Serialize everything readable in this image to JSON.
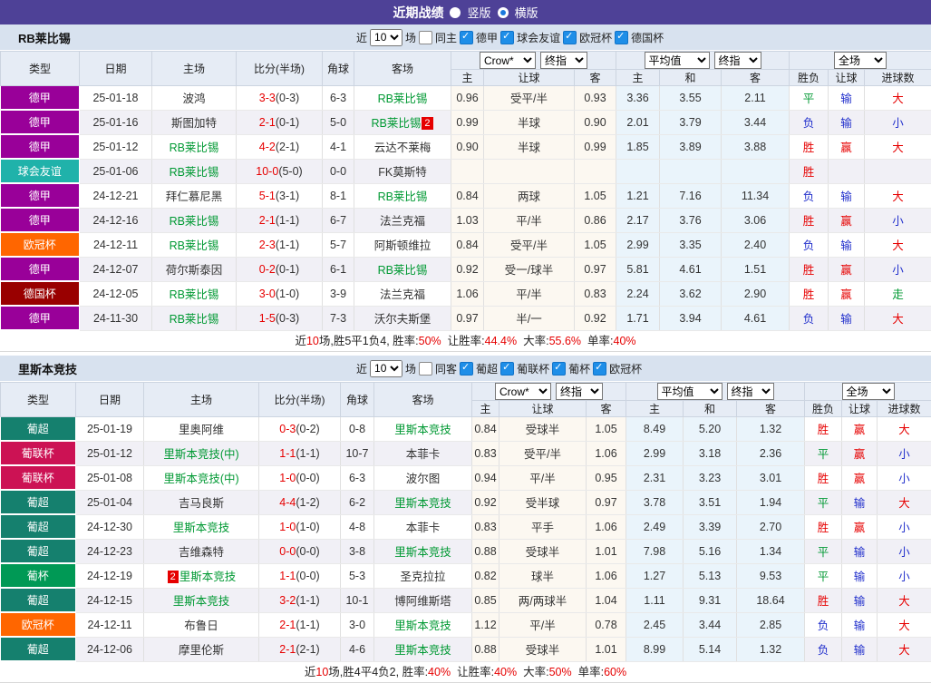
{
  "header": {
    "title": "近期战绩",
    "radio_vertical_label": "竖版",
    "radio_horizontal_label": "横版",
    "selected_layout": "横版"
  },
  "controls": {
    "near_label": "近",
    "near_value": "10",
    "matches_label": "场",
    "bookmaker": "Crow*",
    "final_odds_1": "终指",
    "average": "平均值",
    "final_odds_2": "终指",
    "scope": "全场"
  },
  "columns": {
    "type": "类型",
    "date": "日期",
    "home": "主场",
    "score": "比分(半场)",
    "corner": "角球",
    "away": "客场",
    "h": "主",
    "handicap": "让球",
    "a": "客",
    "avg_h": "主",
    "avg_d": "和",
    "avg_a": "客",
    "wdl": "胜负",
    "let_result": "让球",
    "goals": "进球数"
  },
  "league_colors": {
    "德甲": "#990099",
    "球会友谊": "#20b2aa",
    "欧冠杯": "#ff6600",
    "德国杯": "#990000",
    "葡超": "#15806e",
    "葡联杯": "#cc1254",
    "葡杯": "#009955"
  },
  "result_colors": {
    "胜": "#e60000",
    "平": "#009933",
    "负": "#2230cc",
    "赢": "#e60000",
    "输": "#2230cc",
    "大": "#e60000",
    "小": "#2230cc",
    "走": "#009933"
  },
  "accent_colors": {
    "topbar_purple": "#4e4197",
    "team_green": "#009933",
    "score_red": "#e60000",
    "checkbox_blue": "#1e8ee8"
  },
  "sections": [
    {
      "team": "RB莱比锡",
      "same_label": "同主",
      "same_checked": false,
      "filters": [
        "德甲",
        "球会友谊",
        "欧冠杯",
        "德国杯"
      ],
      "rows": [
        {
          "league": "德甲",
          "date": "25-01-18",
          "home": "波鸿",
          "home_team": false,
          "score": "3-3",
          "half": "(0-3)",
          "corner": "6-3",
          "away": "RB莱比锡",
          "away_team": true,
          "odds": [
            "0.96",
            "受平/半",
            "0.93"
          ],
          "avg": [
            "3.36",
            "3.55",
            "2.11"
          ],
          "res": [
            "平",
            "输",
            "大"
          ]
        },
        {
          "league": "德甲",
          "date": "25-01-16",
          "home": "斯图加特",
          "home_team": false,
          "score": "2-1",
          "half": "(0-1)",
          "corner": "5-0",
          "away": "RB莱比锡",
          "away_team": true,
          "away_badge": "2",
          "away_badge_pos": "after",
          "odds": [
            "0.99",
            "半球",
            "0.90"
          ],
          "avg": [
            "2.01",
            "3.79",
            "3.44"
          ],
          "res": [
            "负",
            "输",
            "小"
          ]
        },
        {
          "league": "德甲",
          "date": "25-01-12",
          "home": "RB莱比锡",
          "home_team": true,
          "score": "4-2",
          "half": "(2-1)",
          "corner": "4-1",
          "away": "云达不莱梅",
          "away_team": false,
          "odds": [
            "0.90",
            "半球",
            "0.99"
          ],
          "avg": [
            "1.85",
            "3.89",
            "3.88"
          ],
          "res": [
            "胜",
            "赢",
            "大"
          ]
        },
        {
          "league": "球会友谊",
          "date": "25-01-06",
          "home": "RB莱比锡",
          "home_team": true,
          "score": "10-0",
          "half": "(5-0)",
          "corner": "0-0",
          "away": "FK莫斯特",
          "away_team": false,
          "odds": [
            "",
            "",
            ""
          ],
          "avg": [
            "",
            "",
            ""
          ],
          "res": [
            "胜",
            "",
            ""
          ]
        },
        {
          "league": "德甲",
          "date": "24-12-21",
          "home": "拜仁慕尼黑",
          "home_team": false,
          "score": "5-1",
          "half": "(3-1)",
          "corner": "8-1",
          "away": "RB莱比锡",
          "away_team": true,
          "odds": [
            "0.84",
            "两球",
            "1.05"
          ],
          "avg": [
            "1.21",
            "7.16",
            "11.34"
          ],
          "res": [
            "负",
            "输",
            "大"
          ]
        },
        {
          "league": "德甲",
          "date": "24-12-16",
          "home": "RB莱比锡",
          "home_team": true,
          "score": "2-1",
          "half": "(1-1)",
          "corner": "6-7",
          "away": "法兰克福",
          "away_team": false,
          "odds": [
            "1.03",
            "平/半",
            "0.86"
          ],
          "avg": [
            "2.17",
            "3.76",
            "3.06"
          ],
          "res": [
            "胜",
            "赢",
            "小"
          ]
        },
        {
          "league": "欧冠杯",
          "date": "24-12-11",
          "home": "RB莱比锡",
          "home_team": true,
          "score": "2-3",
          "half": "(1-1)",
          "corner": "5-7",
          "away": "阿斯顿维拉",
          "away_team": false,
          "odds": [
            "0.84",
            "受平/半",
            "1.05"
          ],
          "avg": [
            "2.99",
            "3.35",
            "2.40"
          ],
          "res": [
            "负",
            "输",
            "大"
          ]
        },
        {
          "league": "德甲",
          "date": "24-12-07",
          "home": "荷尔斯泰因",
          "home_team": false,
          "score": "0-2",
          "half": "(0-1)",
          "corner": "6-1",
          "away": "RB莱比锡",
          "away_team": true,
          "odds": [
            "0.92",
            "受一/球半",
            "0.97"
          ],
          "avg": [
            "5.81",
            "4.61",
            "1.51"
          ],
          "res": [
            "胜",
            "赢",
            "小"
          ]
        },
        {
          "league": "德国杯",
          "date": "24-12-05",
          "home": "RB莱比锡",
          "home_team": true,
          "score": "3-0",
          "half": "(1-0)",
          "corner": "3-9",
          "away": "法兰克福",
          "away_team": false,
          "odds": [
            "1.06",
            "平/半",
            "0.83"
          ],
          "avg": [
            "2.24",
            "3.62",
            "2.90"
          ],
          "res": [
            "胜",
            "赢",
            "走"
          ]
        },
        {
          "league": "德甲",
          "date": "24-11-30",
          "home": "RB莱比锡",
          "home_team": true,
          "score": "1-5",
          "half": "(0-3)",
          "corner": "7-3",
          "away": "沃尔夫斯堡",
          "away_team": false,
          "odds": [
            "0.97",
            "半/一",
            "0.92"
          ],
          "avg": [
            "1.71",
            "3.94",
            "4.61"
          ],
          "res": [
            "负",
            "输",
            "大"
          ]
        }
      ],
      "summary": {
        "parts": [
          {
            "t": "近"
          },
          {
            "t": "10",
            "red": true
          },
          {
            "t": "场,胜5平1负4, 胜率:"
          },
          {
            "t": "50%",
            "red": true
          },
          {
            "t": "让胜率:",
            "gap": true
          },
          {
            "t": "44.4%",
            "red": true
          },
          {
            "t": "大率:",
            "gap": true
          },
          {
            "t": "55.6%",
            "red": true
          },
          {
            "t": "单率:",
            "gap": true
          },
          {
            "t": "40%",
            "red": true
          }
        ]
      }
    },
    {
      "team": "里斯本竞技",
      "same_label": "同客",
      "same_checked": false,
      "filters": [
        "葡超",
        "葡联杯",
        "葡杯",
        "欧冠杯"
      ],
      "rows": [
        {
          "league": "葡超",
          "date": "25-01-19",
          "home": "里奥阿维",
          "home_team": false,
          "score": "0-3",
          "half": "(0-2)",
          "corner": "0-8",
          "away": "里斯本竞技",
          "away_team": true,
          "odds": [
            "0.84",
            "受球半",
            "1.05"
          ],
          "avg": [
            "8.49",
            "5.20",
            "1.32"
          ],
          "res": [
            "胜",
            "赢",
            "大"
          ]
        },
        {
          "league": "葡联杯",
          "date": "25-01-12",
          "home": "里斯本竞技(中)",
          "home_team": true,
          "score": "1-1",
          "half": "(1-1)",
          "corner": "10-7",
          "away": "本菲卡",
          "away_team": false,
          "odds": [
            "0.83",
            "受平/半",
            "1.06"
          ],
          "avg": [
            "2.99",
            "3.18",
            "2.36"
          ],
          "res": [
            "平",
            "赢",
            "小"
          ]
        },
        {
          "league": "葡联杯",
          "date": "25-01-08",
          "home": "里斯本竞技(中)",
          "home_team": true,
          "score": "1-0",
          "half": "(0-0)",
          "corner": "6-3",
          "away": "波尔图",
          "away_team": false,
          "odds": [
            "0.94",
            "平/半",
            "0.95"
          ],
          "avg": [
            "2.31",
            "3.23",
            "3.01"
          ],
          "res": [
            "胜",
            "赢",
            "小"
          ]
        },
        {
          "league": "葡超",
          "date": "25-01-04",
          "home": "吉马良斯",
          "home_team": false,
          "score": "4-4",
          "half": "(1-2)",
          "corner": "6-2",
          "away": "里斯本竞技",
          "away_team": true,
          "odds": [
            "0.92",
            "受半球",
            "0.97"
          ],
          "avg": [
            "3.78",
            "3.51",
            "1.94"
          ],
          "res": [
            "平",
            "输",
            "大"
          ]
        },
        {
          "league": "葡超",
          "date": "24-12-30",
          "home": "里斯本竞技",
          "home_team": true,
          "score": "1-0",
          "half": "(1-0)",
          "corner": "4-8",
          "away": "本菲卡",
          "away_team": false,
          "odds": [
            "0.83",
            "平手",
            "1.06"
          ],
          "avg": [
            "2.49",
            "3.39",
            "2.70"
          ],
          "res": [
            "胜",
            "赢",
            "小"
          ]
        },
        {
          "league": "葡超",
          "date": "24-12-23",
          "home": "吉维森特",
          "home_team": false,
          "score": "0-0",
          "half": "(0-0)",
          "corner": "3-8",
          "away": "里斯本竞技",
          "away_team": true,
          "odds": [
            "0.88",
            "受球半",
            "1.01"
          ],
          "avg": [
            "7.98",
            "5.16",
            "1.34"
          ],
          "res": [
            "平",
            "输",
            "小"
          ]
        },
        {
          "league": "葡杯",
          "date": "24-12-19",
          "home": "里斯本竞技",
          "home_team": true,
          "home_badge": "2",
          "home_badge_pos": "before",
          "score": "1-1",
          "half": "(0-0)",
          "corner": "5-3",
          "away": "圣克拉拉",
          "away_team": false,
          "odds": [
            "0.82",
            "球半",
            "1.06"
          ],
          "avg": [
            "1.27",
            "5.13",
            "9.53"
          ],
          "res": [
            "平",
            "输",
            "小"
          ]
        },
        {
          "league": "葡超",
          "date": "24-12-15",
          "home": "里斯本竞技",
          "home_team": true,
          "score": "3-2",
          "half": "(1-1)",
          "corner": "10-1",
          "away": "博阿维斯塔",
          "away_team": false,
          "odds": [
            "0.85",
            "两/两球半",
            "1.04"
          ],
          "avg": [
            "1.11",
            "9.31",
            "18.64"
          ],
          "res": [
            "胜",
            "输",
            "大"
          ]
        },
        {
          "league": "欧冠杯",
          "date": "24-12-11",
          "home": "布鲁日",
          "home_team": false,
          "score": "2-1",
          "half": "(1-1)",
          "corner": "3-0",
          "away": "里斯本竞技",
          "away_team": true,
          "odds": [
            "1.12",
            "平/半",
            "0.78"
          ],
          "avg": [
            "2.45",
            "3.44",
            "2.85"
          ],
          "res": [
            "负",
            "输",
            "大"
          ]
        },
        {
          "league": "葡超",
          "date": "24-12-06",
          "home": "摩里伦斯",
          "home_team": false,
          "score": "2-1",
          "half": "(2-1)",
          "corner": "4-6",
          "away": "里斯本竞技",
          "away_team": true,
          "odds": [
            "0.88",
            "受球半",
            "1.01"
          ],
          "avg": [
            "8.99",
            "5.14",
            "1.32"
          ],
          "res": [
            "负",
            "输",
            "大"
          ]
        }
      ],
      "summary": {
        "parts": [
          {
            "t": "近"
          },
          {
            "t": "10",
            "red": true
          },
          {
            "t": "场,胜4平4负2, 胜率:"
          },
          {
            "t": "40%",
            "red": true
          },
          {
            "t": "让胜率:",
            "gap": true
          },
          {
            "t": "40%",
            "red": true
          },
          {
            "t": "大率:",
            "gap": true
          },
          {
            "t": "50%",
            "red": true
          },
          {
            "t": "单率:",
            "gap": true
          },
          {
            "t": "60%",
            "red": true
          }
        ]
      }
    }
  ]
}
